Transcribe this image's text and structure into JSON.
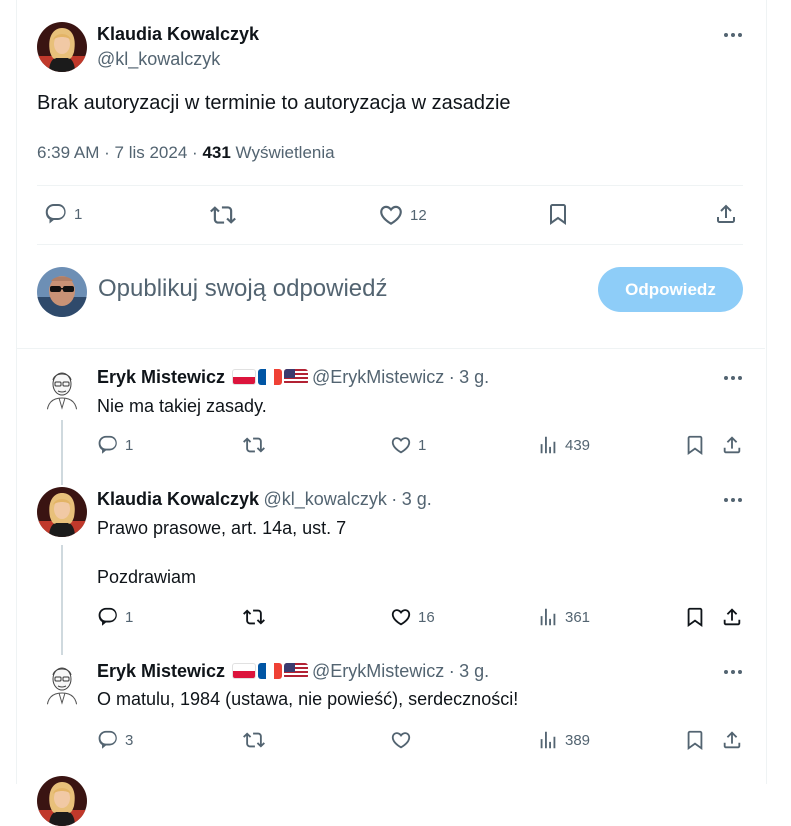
{
  "main_tweet": {
    "author_name": "Klaudia Kowalczyk",
    "author_handle": "@kl_kowalczyk",
    "text": "Brak autoryzacji w terminie to autoryzacja w zasadzie",
    "time": "6:39 AM",
    "date": "7 lis 2024",
    "separator": "·",
    "views_count": "431",
    "views_label": "Wyświetlenia",
    "replies": "1",
    "retweets": "",
    "likes": "12"
  },
  "compose": {
    "placeholder": "Opublikuj swoją odpowiedź",
    "button_label": "Odpowiedz"
  },
  "replies": [
    {
      "author_name": "Eryk Mistewicz",
      "author_handle": "@ErykMistewicz",
      "time_ago": "3 g.",
      "lines": [
        "Nie ma takiej zasady."
      ],
      "replies": "1",
      "retweets": "",
      "likes": "1",
      "views": "439",
      "flags": [
        "pl",
        "fr",
        "us"
      ]
    },
    {
      "author_name": "Klaudia Kowalczyk",
      "author_handle": "@kl_kowalczyk",
      "time_ago": "3 g.",
      "lines": [
        "Prawo prasowe, art. 14a, ust. 7",
        "Pozdrawiam"
      ],
      "replies": "1",
      "retweets": "",
      "likes": "16",
      "views": "361"
    },
    {
      "author_name": "Eryk Mistewicz",
      "author_handle": "@ErykMistewicz",
      "time_ago": "3 g.",
      "lines": [
        "O matulu, 1984 (ustawa, nie powieść), serdeczności!"
      ],
      "replies": "3",
      "retweets": "",
      "likes": "",
      "views": "389",
      "flags": [
        "pl",
        "fr",
        "us"
      ]
    }
  ],
  "colors": {
    "text_primary": "#0f1419",
    "text_secondary": "#536471",
    "button_disabled": "#8ecdf8",
    "border": "#eff3f4",
    "thread_line": "#cfd9de"
  }
}
